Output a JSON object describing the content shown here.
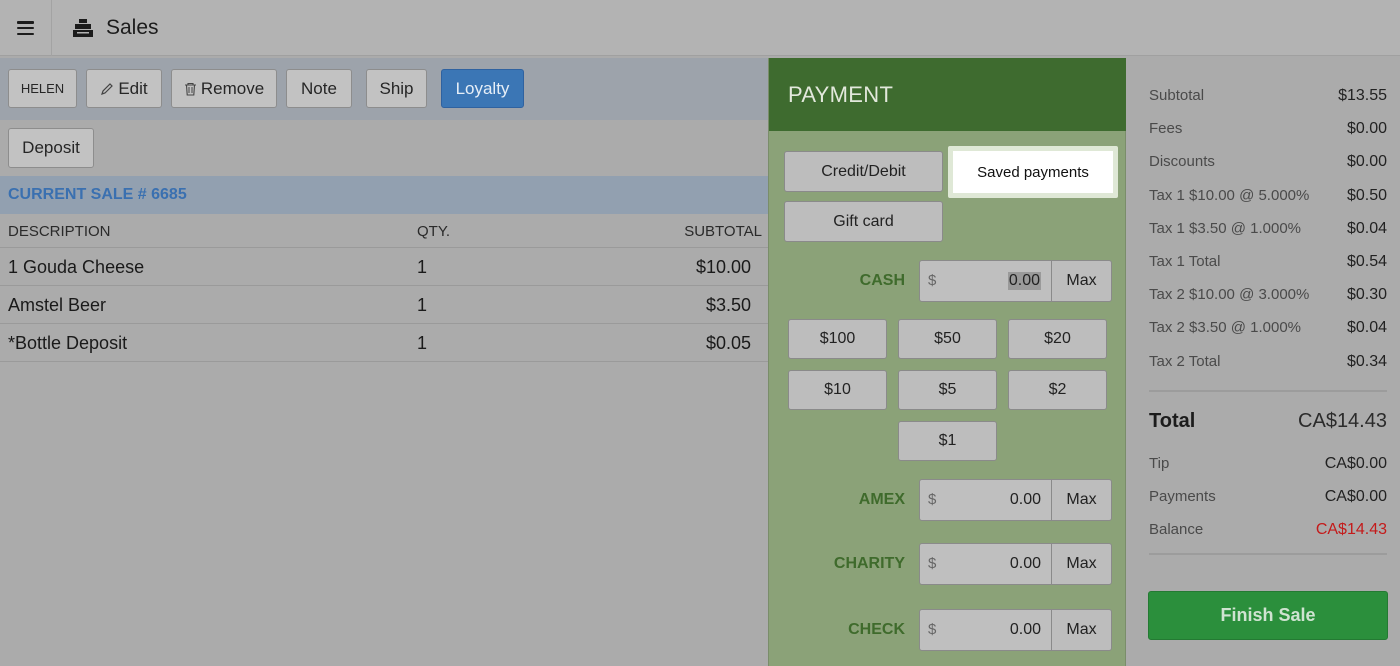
{
  "header": {
    "title": "Sales",
    "menu_icon": "hamburger-menu-icon",
    "app_icon": "cash-register-icon"
  },
  "toolbar": {
    "customer_label": "HELEN",
    "edit_label": "Edit",
    "remove_label": "Remove",
    "note_label": "Note",
    "ship_label": "Ship",
    "loyalty_label": "Loyalty",
    "deposit_label": "Deposit"
  },
  "sale": {
    "title": "CURRENT SALE # 6685",
    "columns": {
      "description": "DESCRIPTION",
      "qty": "QTY.",
      "subtotal": "SUBTOTAL"
    },
    "items": [
      {
        "description": "1 Gouda Cheese",
        "qty": "1",
        "subtotal": "$10.00"
      },
      {
        "description": "Amstel Beer",
        "qty": "1",
        "subtotal": "$3.50"
      },
      {
        "description": "*Bottle Deposit",
        "qty": "1",
        "subtotal": "$0.05"
      }
    ]
  },
  "payment": {
    "title": "PAYMENT",
    "credit_label": "Credit/Debit",
    "saved_label": "Saved payments",
    "giftcard_label": "Gift card",
    "currency_symbol": "$",
    "max_label": "Max",
    "cash": {
      "label": "CASH",
      "value": "0.00"
    },
    "quick_cash": [
      "$100",
      "$50",
      "$20",
      "$10",
      "$5",
      "$2",
      "$1"
    ],
    "amex": {
      "label": "AMEX",
      "value": "0.00"
    },
    "charity": {
      "label": "CHARITY",
      "value": "0.00"
    },
    "check": {
      "label": "CHECK",
      "value": "0.00"
    }
  },
  "summary": {
    "lines": [
      {
        "label": "Subtotal",
        "value": "$13.55"
      },
      {
        "label": "Fees",
        "value": "$0.00"
      },
      {
        "label": "Discounts",
        "value": "$0.00"
      },
      {
        "label": "Tax 1 $10.00 @ 5.000%",
        "value": "$0.50"
      },
      {
        "label": "Tax 1 $3.50 @ 1.000%",
        "value": "$0.04"
      },
      {
        "label": "Tax 1 Total",
        "value": "$0.54"
      },
      {
        "label": "Tax 2 $10.00 @ 3.000%",
        "value": "$0.30"
      },
      {
        "label": "Tax 2 $3.50 @ 1.000%",
        "value": "$0.04"
      },
      {
        "label": "Tax 2 Total",
        "value": "$0.34"
      }
    ],
    "total_label": "Total",
    "total_value": "CA$14.43",
    "tip_label": "Tip",
    "tip_value": "CA$0.00",
    "payments_label": "Payments",
    "payments_value": "CA$0.00",
    "balance_label": "Balance",
    "balance_value": "CA$14.43",
    "balance_color": "#c41a1a",
    "finish_label": "Finish Sale"
  }
}
